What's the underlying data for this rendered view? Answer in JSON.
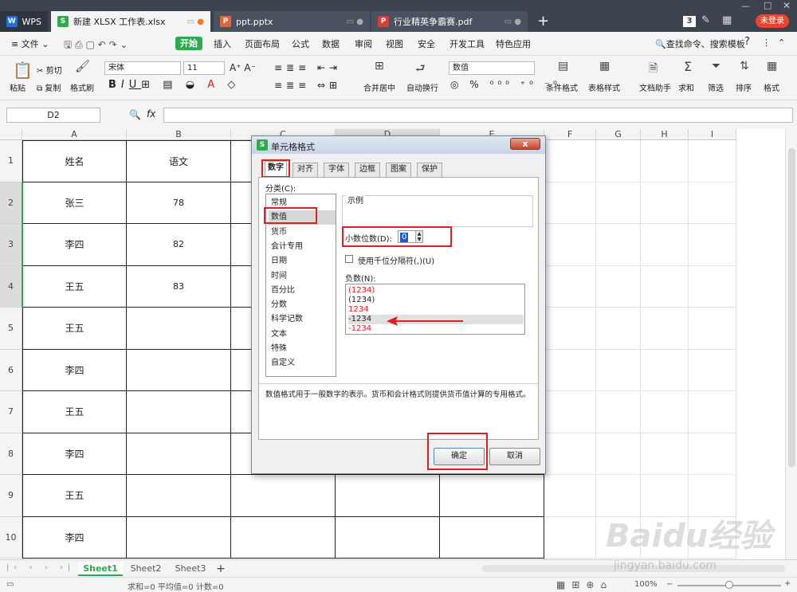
{
  "tabs": [
    {
      "label": "WPS"
    },
    {
      "label": "新建 XLSX 工作表.xlsx",
      "icon": "S"
    },
    {
      "label": "ppt.pptx",
      "icon": "P"
    },
    {
      "label": "行业精英争霸赛.pdf",
      "icon": "P"
    }
  ],
  "tab_badge": "3",
  "login_label": "未登录",
  "menu": {
    "file": "文件",
    "start": "开始",
    "items": [
      "插入",
      "页面布局",
      "公式",
      "数据",
      "审阅",
      "视图",
      "安全",
      "开发工具",
      "特色应用"
    ],
    "search": "查找命令、搜索模板"
  },
  "ribbon": {
    "paste": "粘贴",
    "cut": "剪切",
    "copy": "复制",
    "format_painter": "格式刷",
    "font": "宋体",
    "font_size": "11",
    "merge": "合并居中",
    "wrap": "自动换行",
    "number_format": "数值",
    "cond_format": "条件格式",
    "table_style": "表格样式",
    "doc_helper": "文档助手",
    "sum": "求和",
    "filter": "筛选",
    "sort": "排序",
    "format": "格式"
  },
  "formula": {
    "name_box": "D2",
    "fx": "fx"
  },
  "columns": [
    "A",
    "B",
    "C",
    "D",
    "E",
    "F",
    "G",
    "H",
    "I"
  ],
  "rows": [
    "1",
    "2",
    "3",
    "4",
    "5",
    "6",
    "7",
    "8",
    "9",
    "10"
  ],
  "table": [
    [
      "姓名",
      "语文"
    ],
    [
      "张三",
      "78"
    ],
    [
      "李四",
      "82"
    ],
    [
      "王五",
      "83"
    ],
    [
      "王五",
      ""
    ],
    [
      "李四",
      ""
    ],
    [
      "王五",
      ""
    ],
    [
      "李四",
      ""
    ],
    [
      "王五",
      ""
    ],
    [
      "李四",
      ""
    ]
  ],
  "sheet_tabs": [
    "Sheet1",
    "Sheet2",
    "Sheet3"
  ],
  "status": {
    "text": "求和=0  平均值=0  计数=0",
    "zoom": "100%"
  },
  "dialog": {
    "title": "单元格格式",
    "close": "x",
    "tabs": [
      "数字",
      "对齐",
      "字体",
      "边框",
      "图案",
      "保护"
    ],
    "category_label": "分类(C):",
    "categories": [
      "常规",
      "数值",
      "货币",
      "会计专用",
      "日期",
      "时间",
      "百分比",
      "分数",
      "科学记数",
      "文本",
      "特殊",
      "自定义"
    ],
    "sample_label": "示例",
    "decimal_label": "小数位数(D):",
    "decimal_value": "0",
    "thousands_label": "使用千位分隔符(,)(U)",
    "negative_label": "负数(N):",
    "negatives": [
      "(1234)",
      "(1234)",
      "1234",
      "-1234",
      "-1234"
    ],
    "description": "数值格式用于一般数字的表示。货币和会计格式则提供货币值计算的专用格式。",
    "ok": "确定",
    "cancel": "取消"
  },
  "watermark": "Baidu经验",
  "watermark_url": "jingyan.baidu.com",
  "colors": {
    "accent_green": "#2eab4c",
    "red_highlight": "#e02020",
    "titlebar": "#3c434f",
    "login_red": "#e8442f"
  }
}
